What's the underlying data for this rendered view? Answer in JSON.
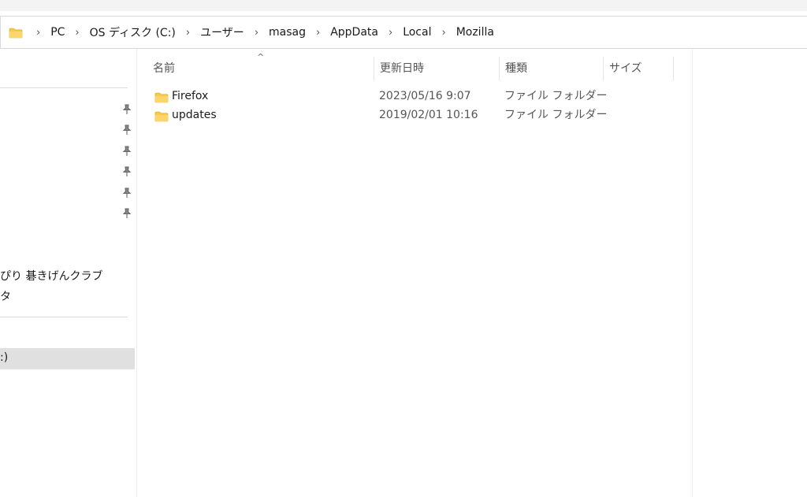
{
  "breadcrumb": {
    "icon": "folder-icon",
    "items": [
      "PC",
      "OS ディスク (C:)",
      "ユーザー",
      "masag",
      "AppData",
      "Local",
      "Mozilla"
    ]
  },
  "columns": {
    "name": "名前",
    "date": "更新日時",
    "type": "種類",
    "size": "サイズ"
  },
  "files": [
    {
      "name": "Firefox",
      "date": "2023/05/16 9:07",
      "type": "ファイル フォルダー"
    },
    {
      "name": "updates",
      "date": "2019/02/01 10:16",
      "type": "ファイル フォルダー"
    }
  ],
  "sidebar": {
    "item_kigen": "ぴり 碁きげんクラブ",
    "item_ta": "タ",
    "item_drive": ":)"
  },
  "colors": {
    "folder": "#f8c94a",
    "selected": "#e0e0e0"
  }
}
